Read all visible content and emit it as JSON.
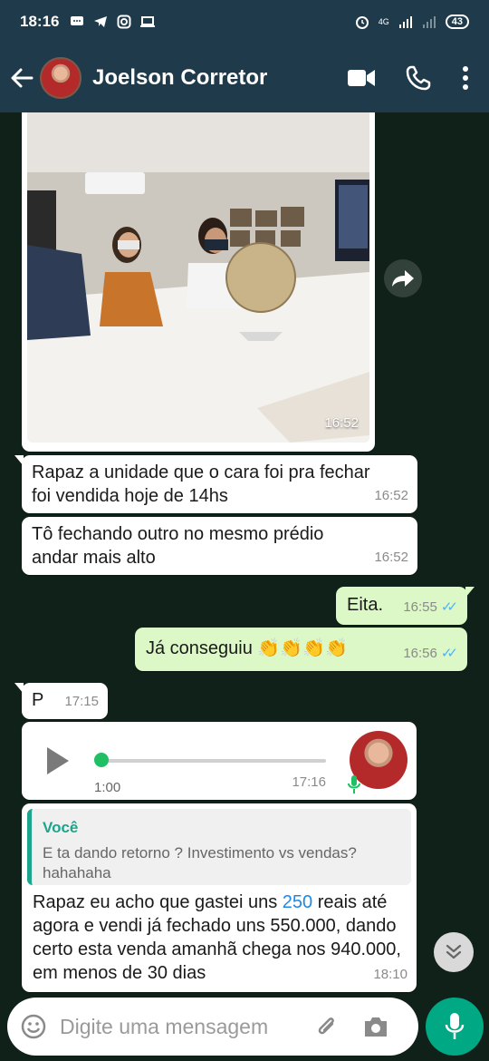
{
  "status_bar": {
    "time": "18:16",
    "network": "4G",
    "battery": "43"
  },
  "header": {
    "contact_name": "Joelson Corretor"
  },
  "messages": [
    {
      "type": "image",
      "direction": "in",
      "time": "16:52"
    },
    {
      "type": "text",
      "direction": "in",
      "text_lines": [
        "Rapaz a unidade que o cara foi pra fechar",
        "foi vendida hoje de 14hs"
      ],
      "time": "16:52"
    },
    {
      "type": "text",
      "direction": "in",
      "text_lines": [
        "Tô fechando outro no mesmo prédio",
        "andar mais alto"
      ],
      "time": "16:52"
    },
    {
      "type": "text",
      "direction": "out",
      "text": "Eita.",
      "time": "16:55",
      "status": "read"
    },
    {
      "type": "text",
      "direction": "out",
      "text": "Já conseguiu 👏👏👏👏",
      "time": "16:56",
      "status": "read"
    },
    {
      "type": "text",
      "direction": "in",
      "text": "P",
      "time": "17:15"
    },
    {
      "type": "voice",
      "direction": "in",
      "duration": "1:00",
      "time": "17:16",
      "progress": 0
    },
    {
      "type": "reply",
      "direction": "in",
      "time": "18:10",
      "quote_author": "Você",
      "quote_text": "E ta dando retorno ? Investimento vs vendas? hahahaha",
      "text_before": "Rapaz eu acho que gastei uns ",
      "highlight": "250",
      "text_after": " reais até agora e vendi já fechado uns 550.000, dando certo esta venda amanhã chega nos 940.000, em menos de 30 dias"
    }
  ],
  "composer": {
    "placeholder": "Digite uma mensagem"
  },
  "colors": {
    "header": "#1f3a4a",
    "outgoing_bubble": "#dcf8c6",
    "incoming_bubble": "#ffffff",
    "accent": "#00a884",
    "read_ticks": "#4fb3f6"
  }
}
